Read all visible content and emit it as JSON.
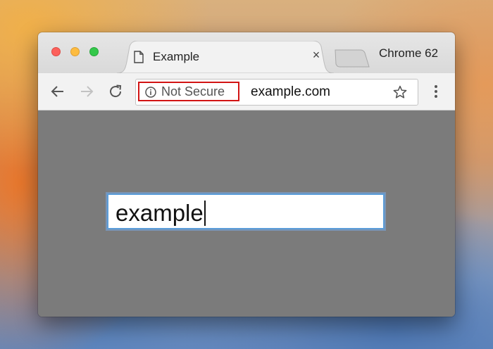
{
  "window": {
    "tab": {
      "title": "Example",
      "close_glyph": "×"
    },
    "browser_label": "Chrome 62",
    "toolbar": {
      "security_label": "Not Secure",
      "url": "example.com"
    }
  },
  "page": {
    "text_field": {
      "value": "example"
    }
  },
  "icons": [
    "close-window-icon",
    "minimize-window-icon",
    "zoom-window-icon",
    "document-icon",
    "close-tab-icon",
    "new-tab-icon",
    "back-arrow-icon",
    "forward-arrow-icon",
    "reload-icon",
    "info-icon",
    "bookmark-star-icon",
    "menu-dots-icon"
  ],
  "colors": {
    "security_highlight": "#d21414",
    "focus_ring": "#5b9dd9",
    "page_background": "#7b7b7b"
  }
}
